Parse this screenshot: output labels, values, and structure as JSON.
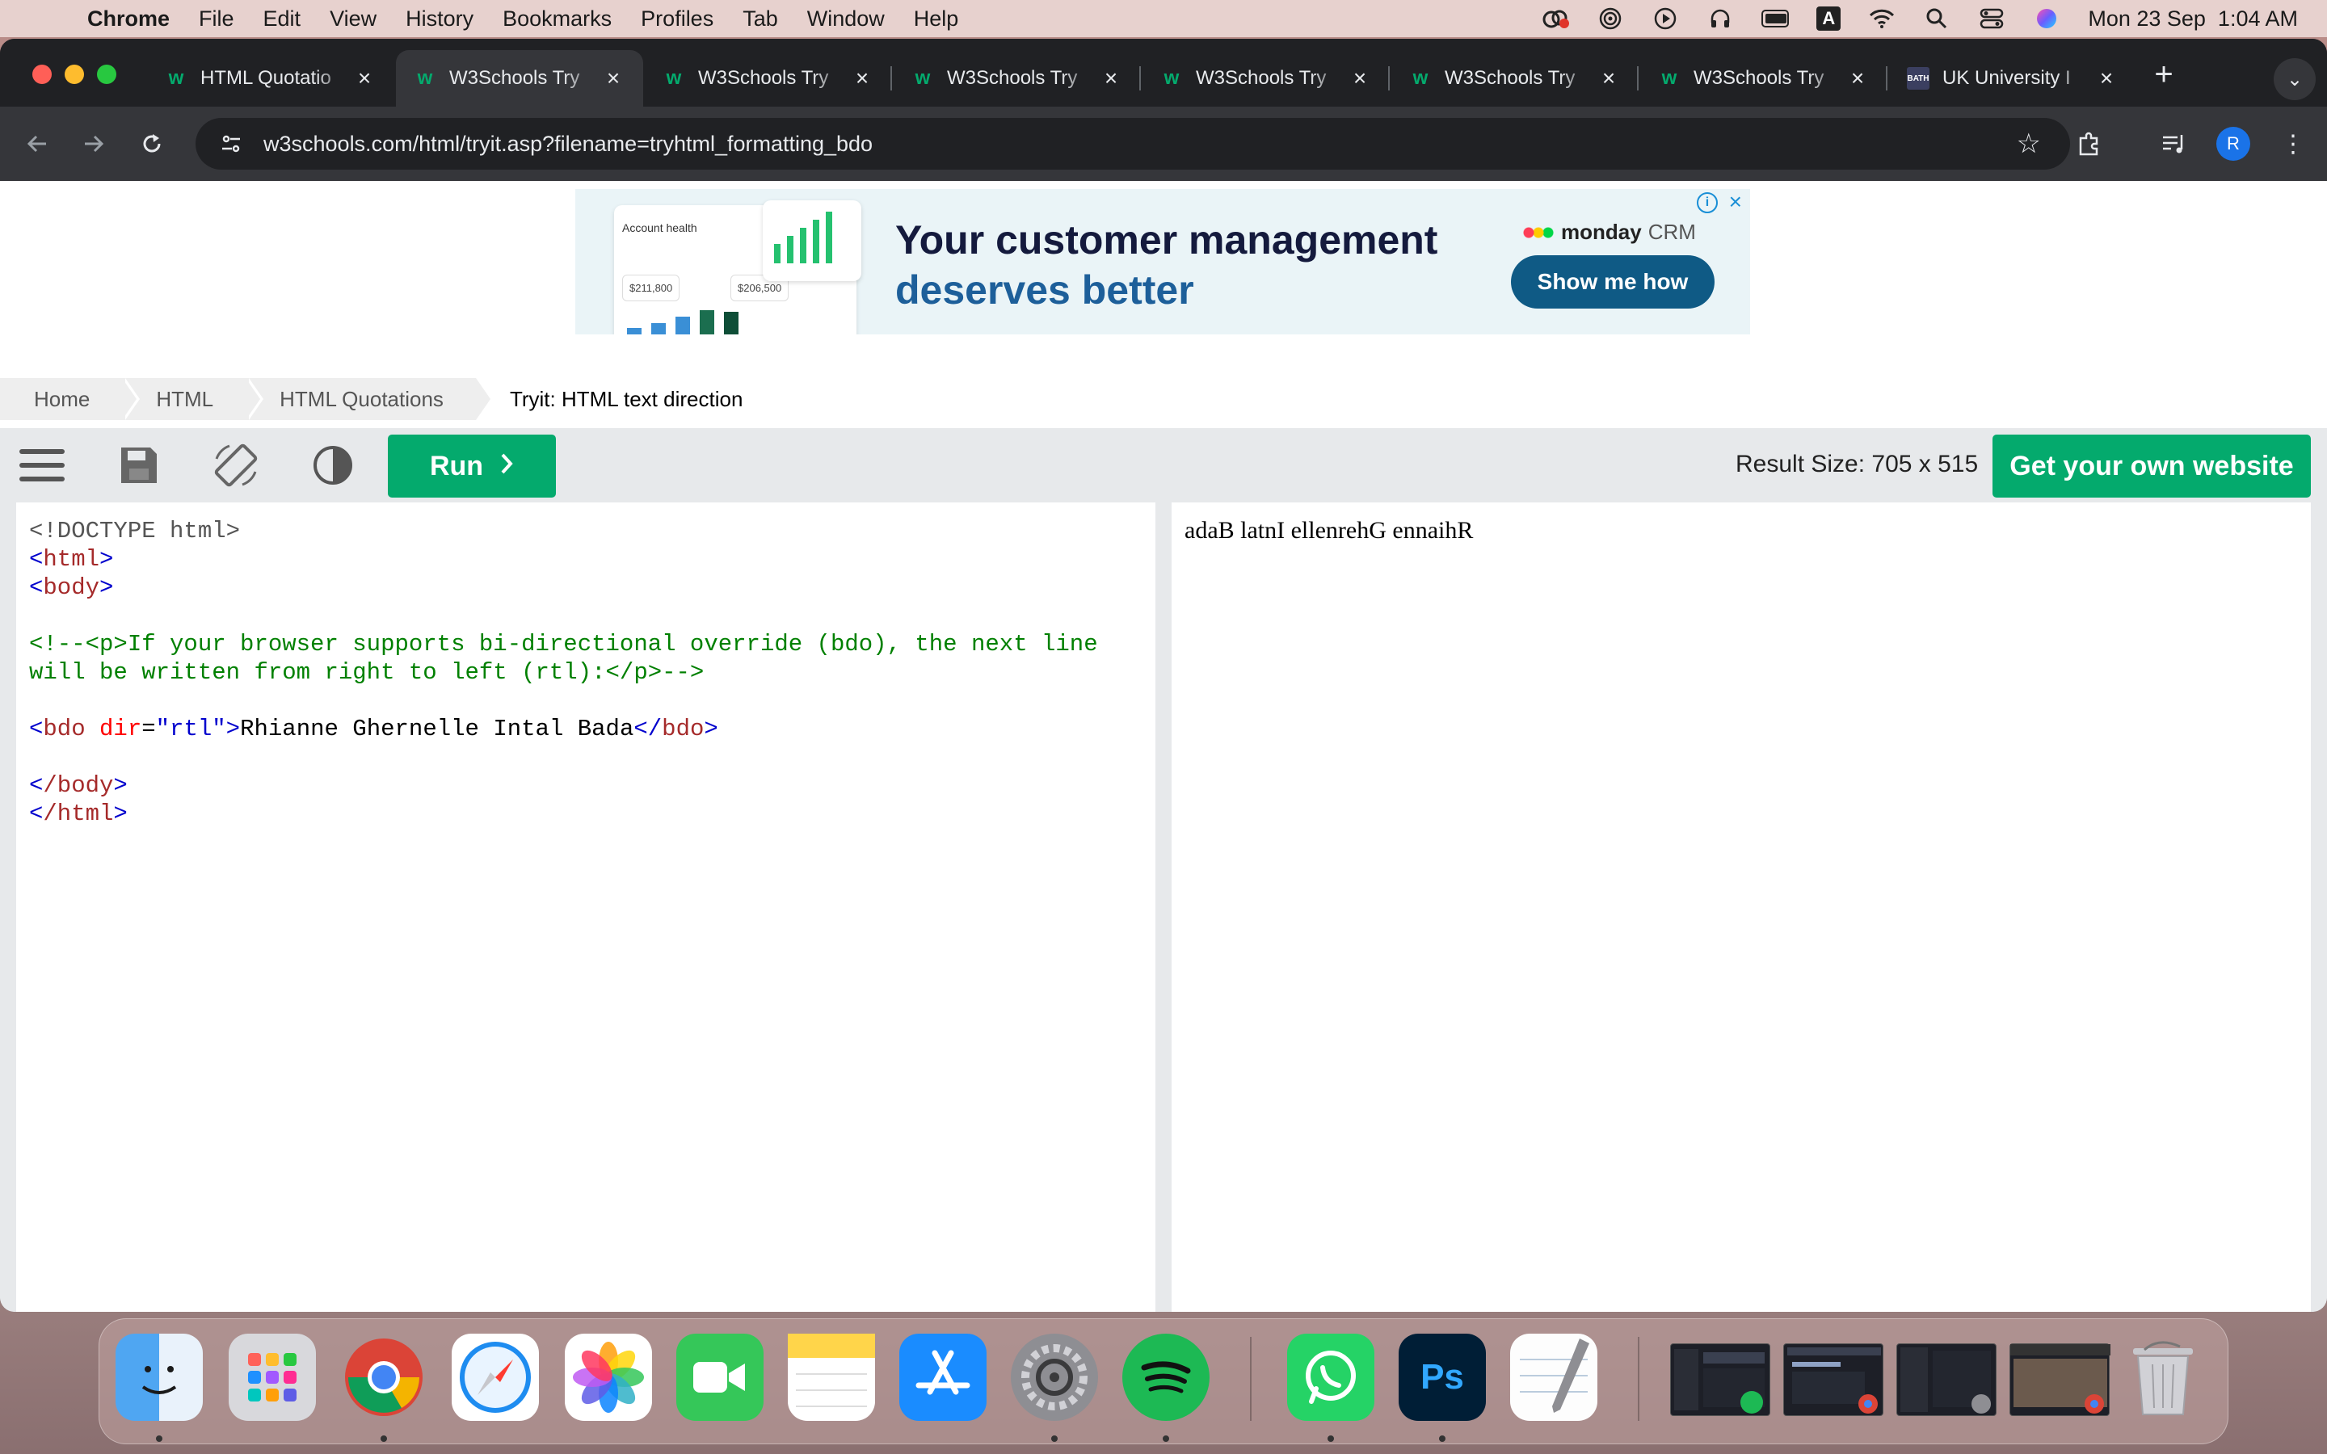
{
  "menubar": {
    "app_name": "Chrome",
    "items": [
      "File",
      "Edit",
      "View",
      "History",
      "Bookmarks",
      "Profiles",
      "Tab",
      "Window",
      "Help"
    ],
    "input_indicator": "A",
    "clock": "Mon 23 Sep  1:04 AM"
  },
  "browser": {
    "tabs": [
      {
        "title": "HTML Quotatio",
        "favicon": "w3schools-icon",
        "active": false
      },
      {
        "title": "W3Schools Try",
        "favicon": "w3schools-icon",
        "active": true
      },
      {
        "title": "W3Schools Try",
        "favicon": "w3schools-icon",
        "active": false
      },
      {
        "title": "W3Schools Try",
        "favicon": "w3schools-icon",
        "active": false
      },
      {
        "title": "W3Schools Try",
        "favicon": "w3schools-icon",
        "active": false
      },
      {
        "title": "W3Schools Try",
        "favicon": "w3schools-icon",
        "active": false
      },
      {
        "title": "W3Schools Try",
        "favicon": "w3schools-icon",
        "active": false
      },
      {
        "title": "UK University I",
        "favicon": "bath-spa-icon",
        "active": false
      }
    ],
    "url": "w3schools.com/html/tryit.asp?filename=tryhtml_formatting_bdo",
    "profile_initial": "R"
  },
  "ad": {
    "card_label": "Account health",
    "card_value_1": "$211,800",
    "card_value_2": "$206,500",
    "headline_line1": "Your customer management",
    "headline_line2": "deserves better",
    "brand_name": "monday",
    "brand_suffix": "CRM",
    "cta": "Show me how",
    "brand_colors": {
      "dark_navy": "#141a3d",
      "blue": "#1d5f9a",
      "cta_bg": "#0f5a85",
      "bg": "#eaf4f7"
    }
  },
  "breadcrumb": [
    "Home",
    "HTML",
    "HTML Quotations",
    "Tryit: HTML text direction"
  ],
  "tryit": {
    "run_label": "Run",
    "result_size": "Result Size: 705 x 515",
    "own_site_label": "Get your own website",
    "accent": "#04aa6d"
  },
  "editor": {
    "doctype": "<!DOCTYPE html>",
    "html_open": "html",
    "body_open": "body",
    "comment": "<!--<p>If your browser supports bi-directional override (bdo), the next line will be written from right to left (rtl):</p>-->",
    "bdo_tag": "bdo",
    "bdo_attr": "dir",
    "bdo_attr_value": "\"rtl\"",
    "bdo_text": "Rhianne Ghernelle Intal Bada",
    "body_close": "/body",
    "html_close": "/html"
  },
  "result": {
    "text": "Rhianne Ghernelle Intal Bada",
    "direction": "rtl"
  },
  "dock": {
    "apps": [
      "finder-icon",
      "launchpad-icon",
      "chrome-icon",
      "safari-icon",
      "photos-icon",
      "facetime-icon",
      "notes-icon",
      "app-store-icon",
      "system-settings-icon",
      "spotify-icon",
      "whatsapp-icon",
      "photoshop-icon",
      "textedit-icon"
    ],
    "photoshop_label": "Ps"
  }
}
